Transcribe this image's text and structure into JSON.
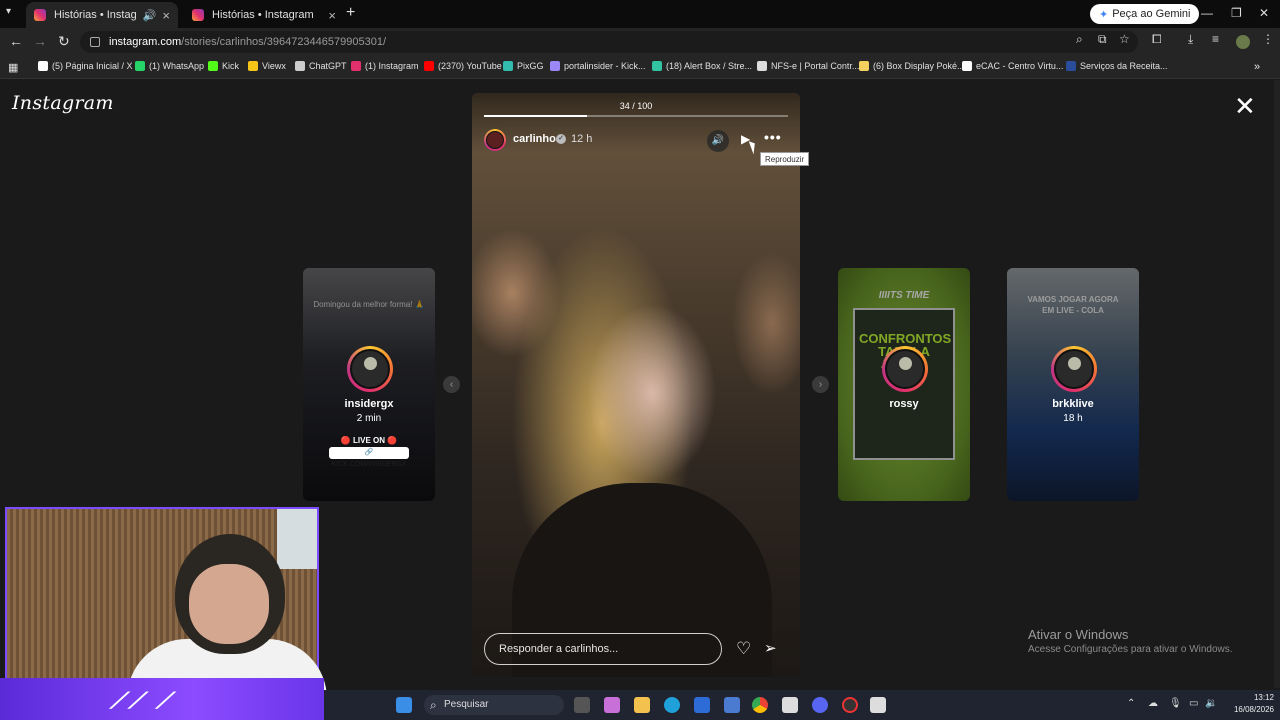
{
  "browser": {
    "tabs": [
      {
        "title": "Histórias • Instagram",
        "active": true,
        "playing_audio": true
      },
      {
        "title": "Histórias • Instagram",
        "active": false,
        "playing_audio": false
      }
    ],
    "gemini_button": "Peça ao Gemini",
    "url_host": "instagram.com",
    "url_path": "/stories/carlinhos/3964723446579905301/",
    "bookmarks": [
      {
        "label": "(5) Página Inicial / X",
        "icon": "x-icon",
        "color": "#ffffff"
      },
      {
        "label": "(1) WhatsApp",
        "icon": "whatsapp-icon",
        "color": "#25d366"
      },
      {
        "label": "Kick",
        "icon": "kick-icon",
        "color": "#53fc18"
      },
      {
        "label": "Viewx",
        "icon": "viewx-icon",
        "color": "#f5c518"
      },
      {
        "label": "ChatGPT",
        "icon": "chatgpt-icon",
        "color": "#cccccc"
      },
      {
        "label": "(1) Instagram",
        "icon": "instagram-icon",
        "color": "#e1306c"
      },
      {
        "label": "(2370) YouTube",
        "icon": "youtube-icon",
        "color": "#ff0000"
      },
      {
        "label": "PixGG",
        "icon": "pixgg-icon",
        "color": "#32bcad"
      },
      {
        "label": "portalinsider - Kick...",
        "icon": "portal-icon",
        "color": "#9b87f5"
      },
      {
        "label": "(18) Alert Box / Stre...",
        "icon": "alertbox-icon",
        "color": "#31c3a2"
      },
      {
        "label": "NFS-e | Portal Contr...",
        "icon": "nfse-icon",
        "color": "#dddddd"
      },
      {
        "label": "(6) Box Display Poké...",
        "icon": "pokemon-icon",
        "color": "#f2d060"
      },
      {
        "label": "eCAC - Centro Virtu...",
        "icon": "ecac-icon",
        "color": "#ffffff"
      },
      {
        "label": "Serviços da Receita...",
        "icon": "receita-icon",
        "color": "#2a4d9b"
      }
    ]
  },
  "instagram": {
    "logo": "Instagram",
    "progress_label": "34 / 100",
    "progress_fraction": 0.34,
    "main_story": {
      "username": "carlinhos",
      "verified": "✓",
      "time": "12 h",
      "reply_placeholder": "Responder a carlinhos...",
      "tooltip": "Reproduzir"
    },
    "side_stories": [
      {
        "username": "insidergx",
        "time": "2 min",
        "caption_top": "Domingou da melhor forma! 🙏",
        "live_text": "🔴 LIVE ON 🔴",
        "link_text": "🔗 KICK.COM/INSIDERGX"
      },
      {
        "username": "rossy",
        "time": "",
        "caption_top": "IIIITS TIME",
        "poster_title": "CONFRONTOS TABELA JOGOS"
      },
      {
        "username": "brkklive",
        "time": "18 h",
        "caption_top": "VAMOS JOGAR AGORA EM LIVE - COLA"
      }
    ]
  },
  "windows": {
    "activation_title": "Ativar o Windows",
    "activation_subtitle": "Acesse Configurações para ativar o Windows.",
    "search_placeholder": "Pesquisar",
    "time": "13:12",
    "date": "16/08/2026"
  }
}
